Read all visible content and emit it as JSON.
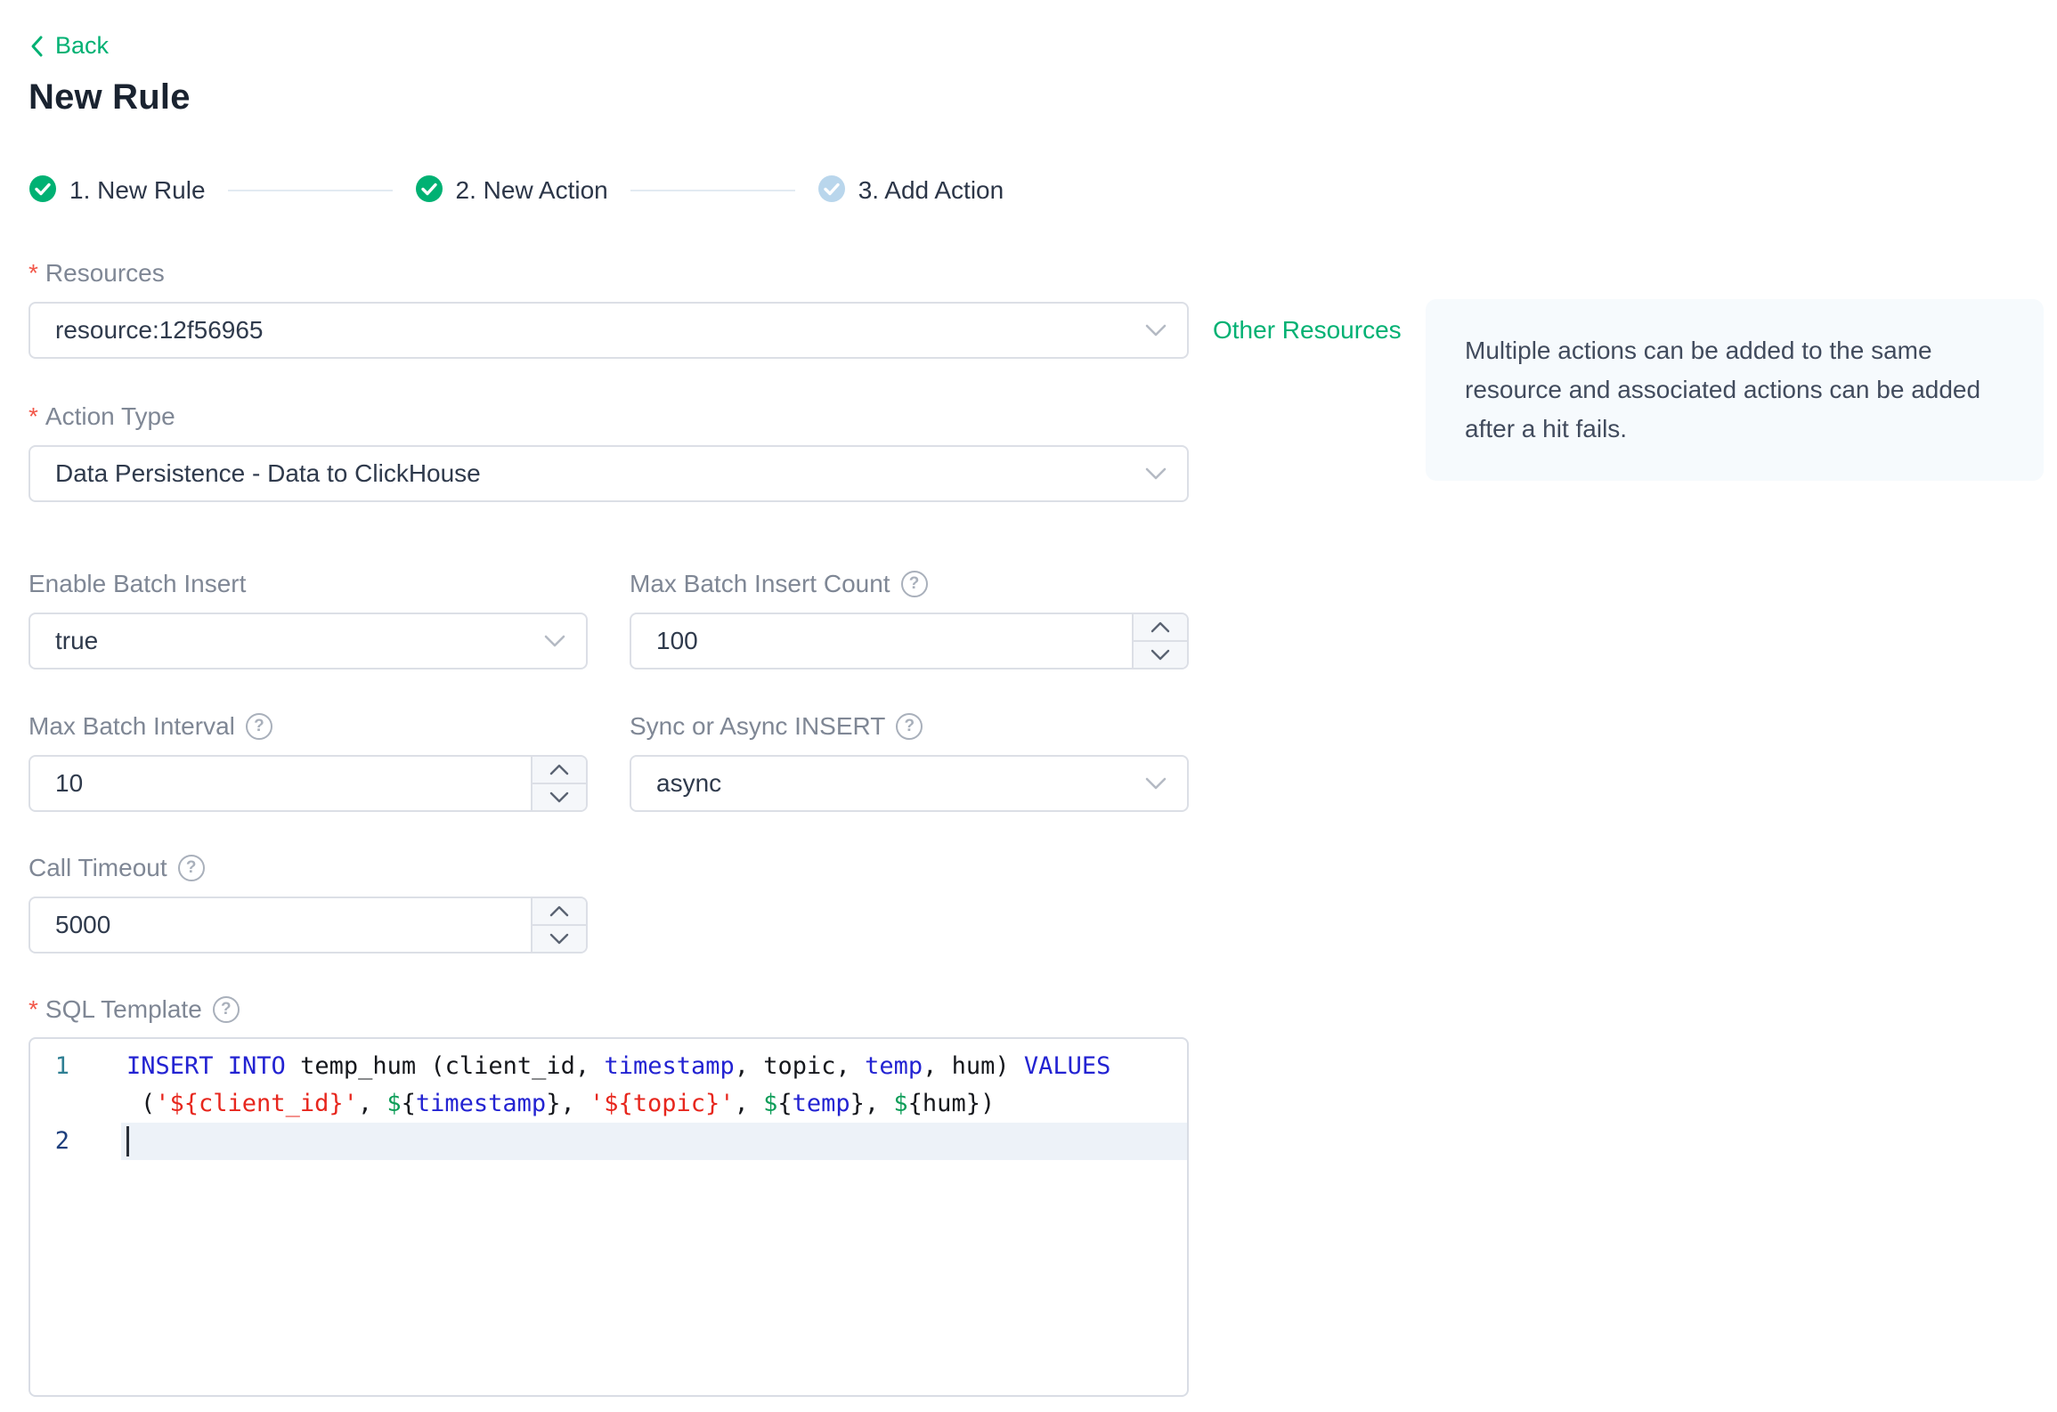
{
  "colors": {
    "accent_green": "#00b173",
    "required_red": "#f25749",
    "pending_step_blue": "#b9d6ec",
    "info_box_bg": "#f6fafd",
    "keyword_blue": "#2323d2",
    "string_red": "#e7261d",
    "dollar_green": "#0d9d58",
    "active_line_bg": "#edf2f8"
  },
  "header": {
    "back_label": "Back",
    "title": "New Rule"
  },
  "steps": [
    {
      "label": "1. New Rule",
      "state": "done"
    },
    {
      "label": "2. New Action",
      "state": "done"
    },
    {
      "label": "3. Add Action",
      "state": "pending"
    }
  ],
  "form": {
    "resources": {
      "label": "Resources",
      "value": "resource:12f56965",
      "other_resources_label": "Other Resources"
    },
    "action_type": {
      "label": "Action Type",
      "value": "Data Persistence - Data to ClickHouse"
    },
    "enable_batch_insert": {
      "label": "Enable Batch Insert",
      "value": "true"
    },
    "max_batch_insert_count": {
      "label": "Max Batch Insert Count",
      "value": "100"
    },
    "max_batch_interval": {
      "label": "Max Batch Interval",
      "value": "10"
    },
    "sync_or_async_insert": {
      "label": "Sync or Async INSERT",
      "value": "async"
    },
    "call_timeout": {
      "label": "Call Timeout",
      "value": "5000"
    },
    "sql_template": {
      "label": "SQL Template"
    }
  },
  "info_box": {
    "text": "Multiple actions can be added to the same resource and associated actions can be added after a hit fails."
  },
  "sql_editor": {
    "sql": "INSERT INTO temp_hum (client_id, timestamp, topic, temp, hum) VALUES ('${client_id}', ${timestamp}, '${topic}', ${temp}, ${hum})",
    "rows": [
      {
        "num": "1",
        "num_cls": "n1",
        "active": false,
        "indent": false,
        "tokens": [
          [
            "INSERT INTO",
            "kw"
          ],
          [
            " temp_hum (client_id, ",
            "pl"
          ],
          [
            "timestamp",
            "kw"
          ],
          [
            ", topic, ",
            "pl"
          ],
          [
            "temp",
            "kw"
          ],
          [
            ", hum) ",
            "pl"
          ],
          [
            "VALUES",
            "kw"
          ]
        ]
      },
      {
        "num": "",
        "num_cls": "",
        "active": false,
        "indent": true,
        "tokens": [
          [
            "(",
            "pl"
          ],
          [
            "'${client_id}'",
            "str"
          ],
          [
            ", ",
            "pl"
          ],
          [
            "$",
            "var"
          ],
          [
            "{",
            "pl"
          ],
          [
            "timestamp",
            "kw"
          ],
          [
            "}, ",
            "pl"
          ],
          [
            "'${topic}'",
            "str"
          ],
          [
            ", ",
            "pl"
          ],
          [
            "$",
            "var"
          ],
          [
            "{",
            "pl"
          ],
          [
            "temp",
            "kw"
          ],
          [
            "}, ",
            "pl"
          ],
          [
            "$",
            "var"
          ],
          [
            "{hum})",
            "pl"
          ]
        ]
      },
      {
        "num": "2",
        "num_cls": "n2",
        "active": true,
        "indent": false,
        "tokens": []
      }
    ]
  }
}
